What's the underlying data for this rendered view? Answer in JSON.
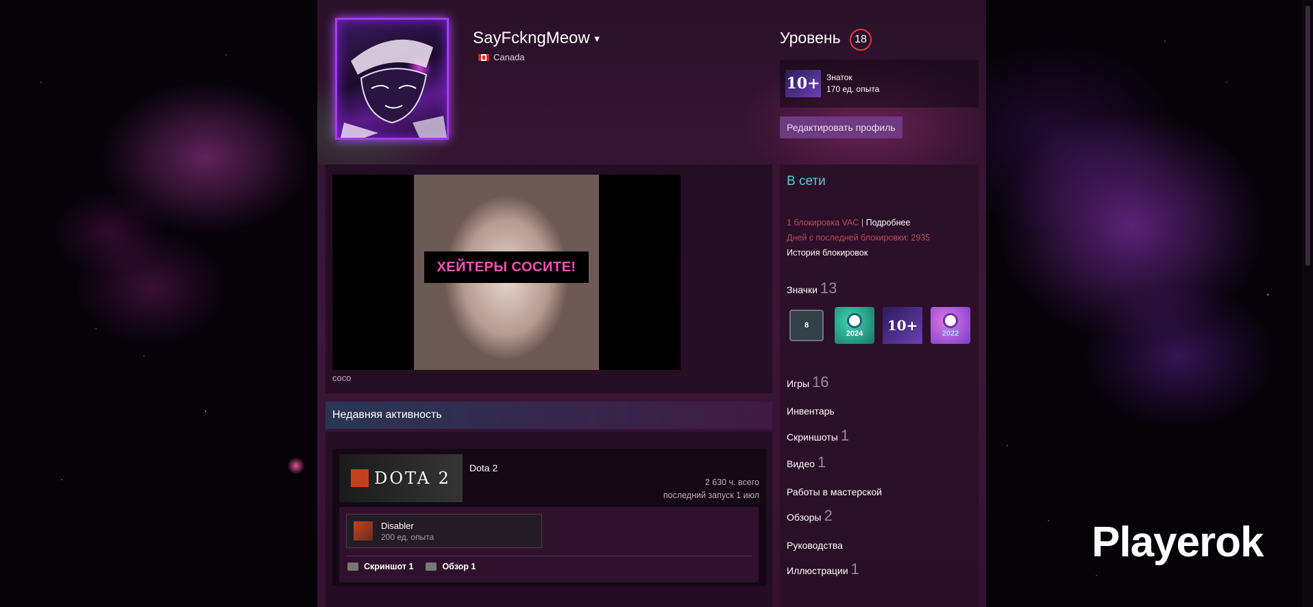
{
  "profile": {
    "username": "SayFckngMeow",
    "country": "Canada"
  },
  "level": {
    "label": "Уровень",
    "value": "18",
    "xp_badge": "10+",
    "xp_title": "Знаток",
    "xp_amount": "170 ед. опыта",
    "edit_button": "Редактировать профиль"
  },
  "showcase": {
    "banner_text": "ХЕЙТЕРЫ СОСИТЕ!",
    "caption": "coco"
  },
  "recent": {
    "header": "Недавняя активность",
    "game_logo_text": "DOTA 2",
    "game_title": "Dota 2",
    "hours_total": "2 630 ч. всего",
    "last_played": "последний запуск 1 июл",
    "achievement_name": "Disabler",
    "achievement_xp": "200 ед. опыта",
    "screenshot_link": "Скриншот 1",
    "review_link": "Обзор 1"
  },
  "sidebar": {
    "status": "В сети",
    "vac": "1 блокировка VAC",
    "vac_sep": "|",
    "vac_more": "Подробнее",
    "days_since": "Дней с последней блокировки: 2935",
    "ban_history": "История блокировок",
    "badges_label": "Значки",
    "badges_count": "13",
    "badge_items": [
      "8",
      "2024",
      "10+",
      "2022"
    ],
    "games_label": "Игры",
    "games_count": "16",
    "inventory_label": "Инвентарь",
    "screenshots_label": "Скриншоты",
    "screenshots_count": "1",
    "videos_label": "Видео",
    "videos_count": "1",
    "workshop_label": "Работы в мастерской",
    "reviews_label": "Обзоры",
    "reviews_count": "2",
    "guides_label": "Руководства",
    "artwork_label": "Иллюстрации",
    "artwork_count": "1"
  },
  "watermark": "Playerok",
  "colors": {
    "accent_online": "#57cbde",
    "vac_red": "#b34e60",
    "edit_button_bg": "#6e3a82",
    "level_ring": "#e03b45"
  }
}
